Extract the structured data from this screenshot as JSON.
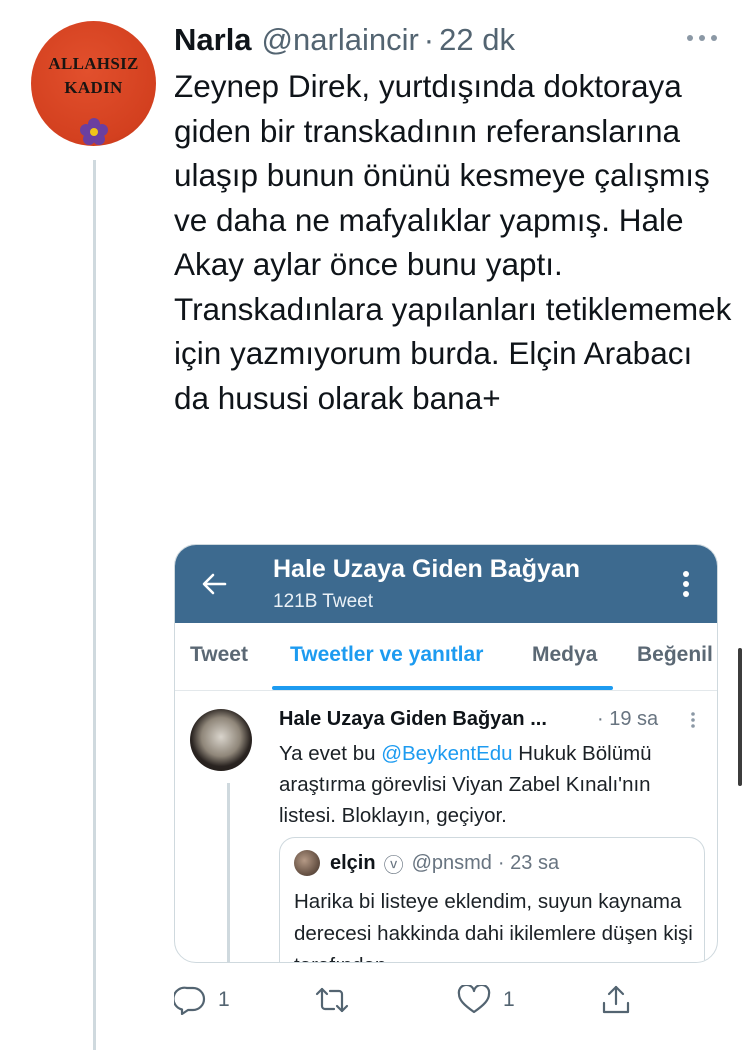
{
  "tweet": {
    "author_name": "Narla",
    "handle": "@narlaincir",
    "separator": "·",
    "time": "22 dk",
    "avatar_badge": {
      "line1": "ALLAHSIZ",
      "line2": "KADIN"
    },
    "text": "Zeynep Direk, yurtdışında doktoraya giden bir transkadının referanslarına ulaşıp bunun önünü kesmeye çalışmış ve daha ne mafyalıklar yapmış. Hale Akay aylar önce bunu yaptı. Transkadınlara yapılanları tetiklememek için yazmıyorum burda. Elçin Arabacı da hususi olarak bana+"
  },
  "embedded_screenshot": {
    "header": {
      "title": "Hale Uzaya Giden Bağyan",
      "subtitle": "121B Tweet"
    },
    "tabs": [
      {
        "label": "Tweet",
        "active": false
      },
      {
        "label": "Tweetler ve yanıtlar",
        "active": true
      },
      {
        "label": "Medya",
        "active": false
      },
      {
        "label": "Beğenil",
        "active": false
      }
    ],
    "inner_tweet": {
      "name": "Hale Uzaya Giden Bağyan ...",
      "time": "· 19 sa",
      "text_before": "Ya evet bu ",
      "mention": "@BeykentEdu",
      "text_after": " Hukuk Bölümü araştırma görevlisi   Viyan Zabel Kınalı'nın listesi. Bloklayın, geçiyor."
    },
    "quoted_tweet": {
      "name": "elçin",
      "verified_symbol": "ⓥ",
      "handle": "@pnsmd",
      "time": "· 23 sa",
      "text": "Harika bi listeye eklendim, suyun kaynama derecesi hakkinda dahi ikilemlere düşen kişi tarafından"
    }
  },
  "actions": {
    "reply_count": "1",
    "like_count": "1"
  },
  "colors": {
    "accent": "#1d9bf0",
    "app_header": "#3d6a8f",
    "avatar_badge": "#d3401f"
  }
}
